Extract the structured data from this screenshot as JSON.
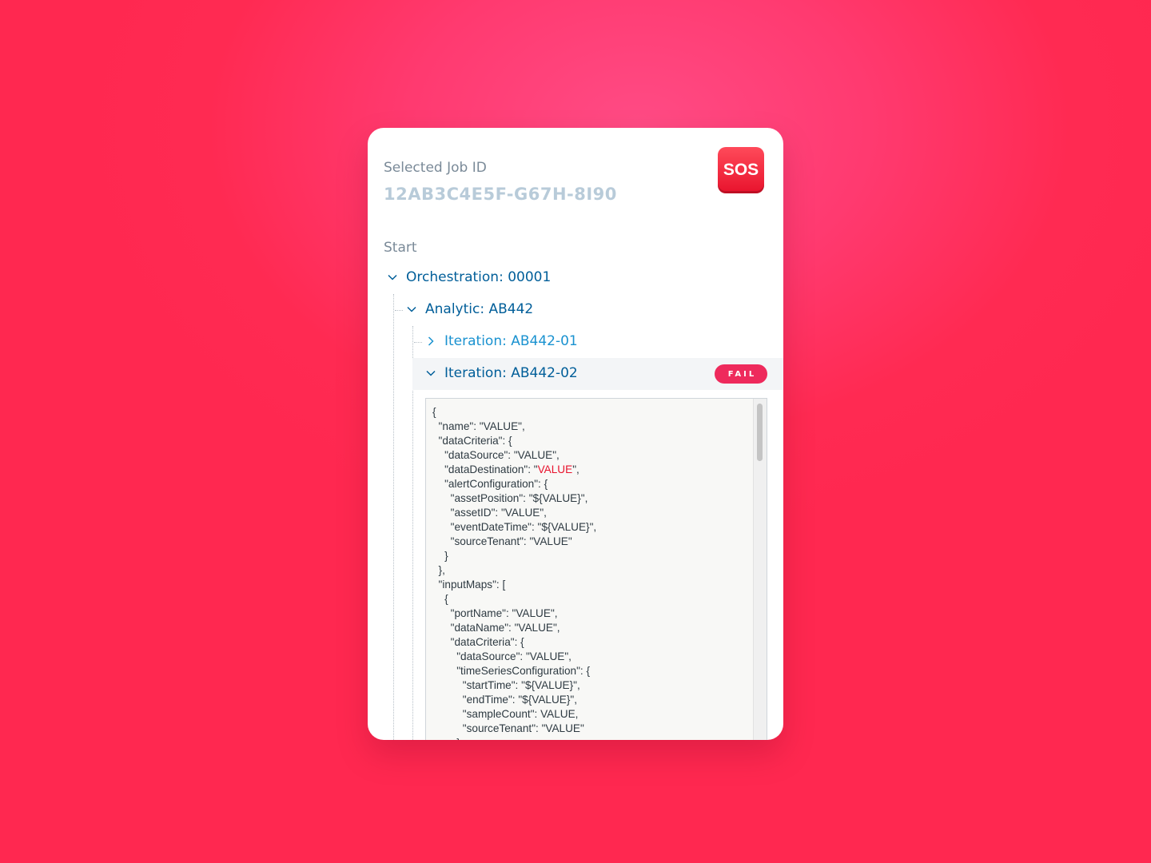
{
  "job": {
    "label": "Selected Job ID",
    "id": "12AB3C4E5F-G67H-8I90"
  },
  "sos_button": {
    "label": "SOS",
    "color": "#e8122c"
  },
  "tree": {
    "start_label": "Start",
    "orchestration": "Orchestration: 00001",
    "analytic": "Analytic: AB442",
    "iteration_1": "Iteration: AB442-01",
    "iteration_2": "Iteration: AB442-02",
    "status_badge": "FAIL"
  },
  "code": {
    "lines": [
      "{",
      "  \"name\": \"VALUE\",",
      "  \"dataCriteria\": {",
      "    \"dataSource\": \"VALUE\",",
      "    \"dataDestination\": \"|VALUE|\",",
      "    \"alertConfiguration\": {",
      "      \"assetPosition\": \"${VALUE}\",",
      "      \"assetID\": \"VALUE\",",
      "      \"eventDateTime\": \"${VALUE}\",",
      "      \"sourceTenant\": \"VALUE\"",
      "    }",
      "  },",
      "  \"inputMaps\": [",
      "    {",
      "      \"portName\": \"VALUE\",",
      "      \"dataName\": \"VALUE\",",
      "      \"dataCriteria\": {",
      "        \"dataSource\": \"VALUE\",",
      "        \"timeSeriesConfiguration\": {",
      "          \"startTime\": \"${VALUE}\",",
      "          \"endTime\": \"${VALUE}\",",
      "          \"sampleCount\": VALUE,",
      "          \"sourceTenant\": \"VALUE\"",
      "        }"
    ]
  }
}
